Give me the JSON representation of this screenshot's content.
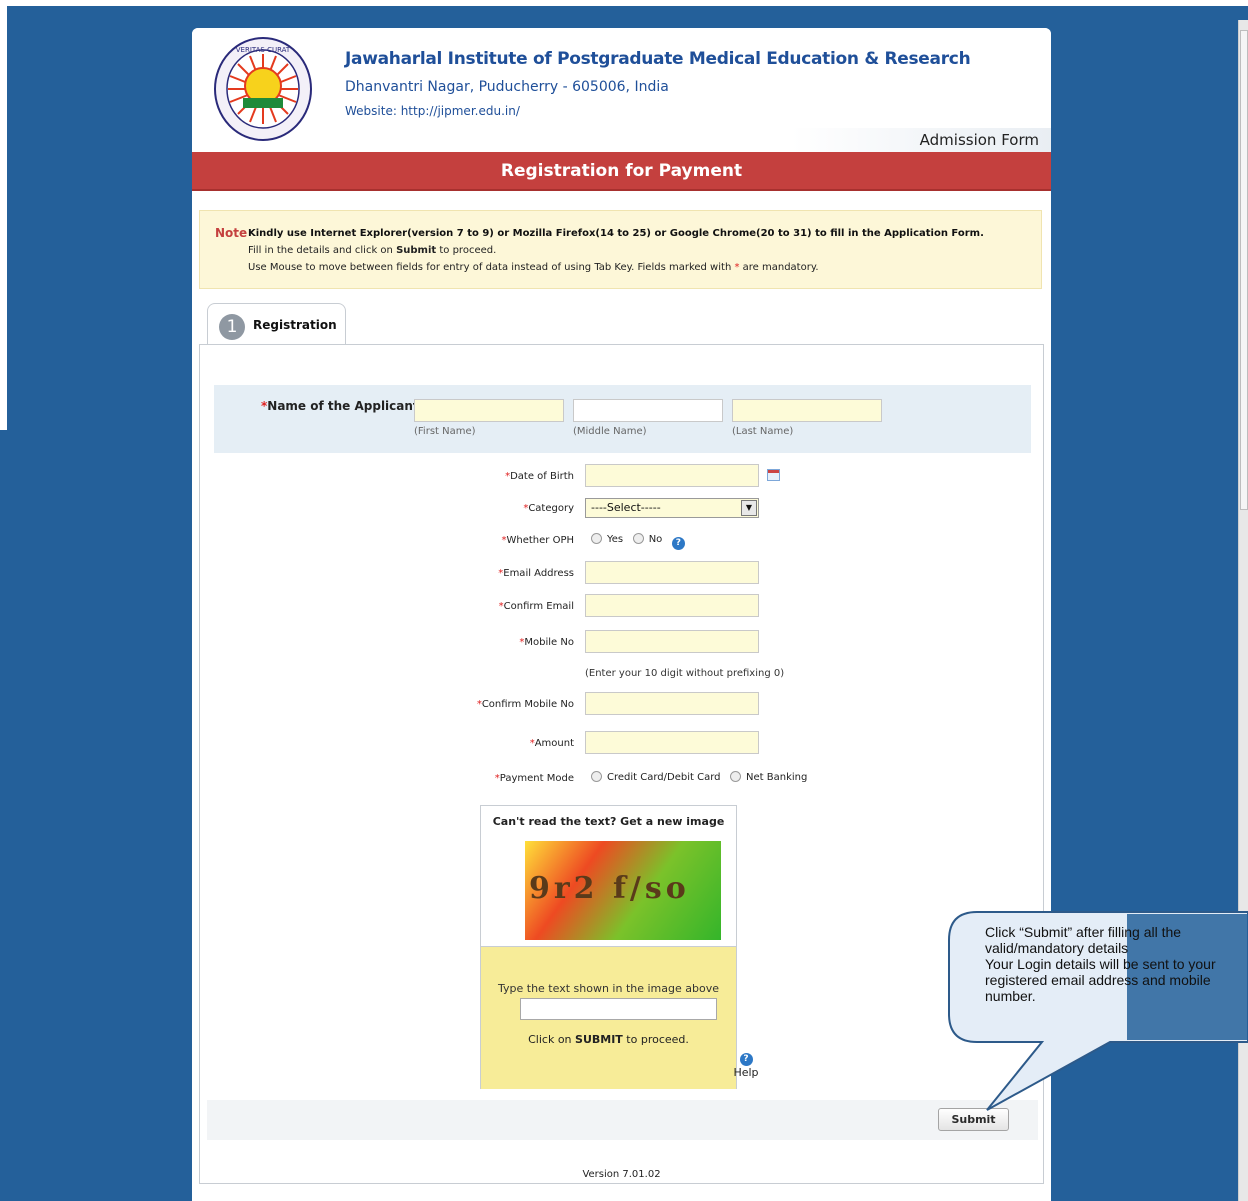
{
  "header": {
    "institute_name": "Jawaharlal Institute of Postgraduate Medical Education & Research",
    "address": "Dhanvantri Nagar, Puducherry - 605006, India",
    "website": "Website: http://jipmer.edu.in/",
    "form_type": "Admission Form",
    "logo_text": "VERITAS CURAT"
  },
  "page_title": "Registration for Payment",
  "note": {
    "label": "Note",
    "line1": "Kindly use Internet Explorer(version 7 to 9) or Mozilla Firefox(14 to 25) or Google Chrome(20 to 31) to fill in the Application Form.",
    "line2_prefix": "Fill in the details and click on ",
    "line2_bold": "Submit",
    "line2_suffix": " to proceed.",
    "line3_prefix": "Use Mouse to move between fields for entry of data instead of using Tab Key. Fields marked with ",
    "line3_star": "*",
    "line3_suffix": " are mandatory."
  },
  "tab": {
    "number": "1",
    "label": "Registration"
  },
  "form": {
    "name_label": "Name of the Applicant",
    "first_name_hint": "(First Name)",
    "middle_name_hint": "(Middle Name)",
    "last_name_hint": "(Last Name)",
    "dob_label": "Date of Birth",
    "category_label": "Category",
    "category_value": "----Select-----",
    "oph_label": "Whether OPH",
    "oph_yes": "Yes",
    "oph_no": "No",
    "email_label": "Email Address",
    "confirm_email_label": "Confirm Email",
    "mobile_label": "Mobile No",
    "mobile_hint": "(Enter your 10 digit without prefixing 0)",
    "confirm_mobile_label": "Confirm Mobile No",
    "amount_label": "Amount",
    "payment_mode_label": "Payment Mode",
    "payment_card": "Credit Card/Debit Card",
    "payment_netbanking": "Net Banking",
    "required_mark": "*"
  },
  "captcha": {
    "refresh_text": "Can't read the text? Get a new image",
    "image_text": "9r2 f/so",
    "instruction": "Type the text shown in the image above",
    "proceed_prefix": "Click on ",
    "proceed_bold": "SUBMIT",
    "proceed_suffix": " to proceed.",
    "help_label": "Help",
    "help_icon": "?"
  },
  "submit_label": "Submit",
  "version": "Version 7.01.02",
  "tooltip": {
    "text": "Click “Submit” after filling all the valid/mandatory details\nYour Login details will be sent to your registered email address and mobile number."
  },
  "colors": {
    "background": "#24609a",
    "title_bar": "#c4403e",
    "institute_text": "#1f4f99",
    "input_fill": "#fdfbd8",
    "tooltip_fill": "#e4edf7"
  }
}
